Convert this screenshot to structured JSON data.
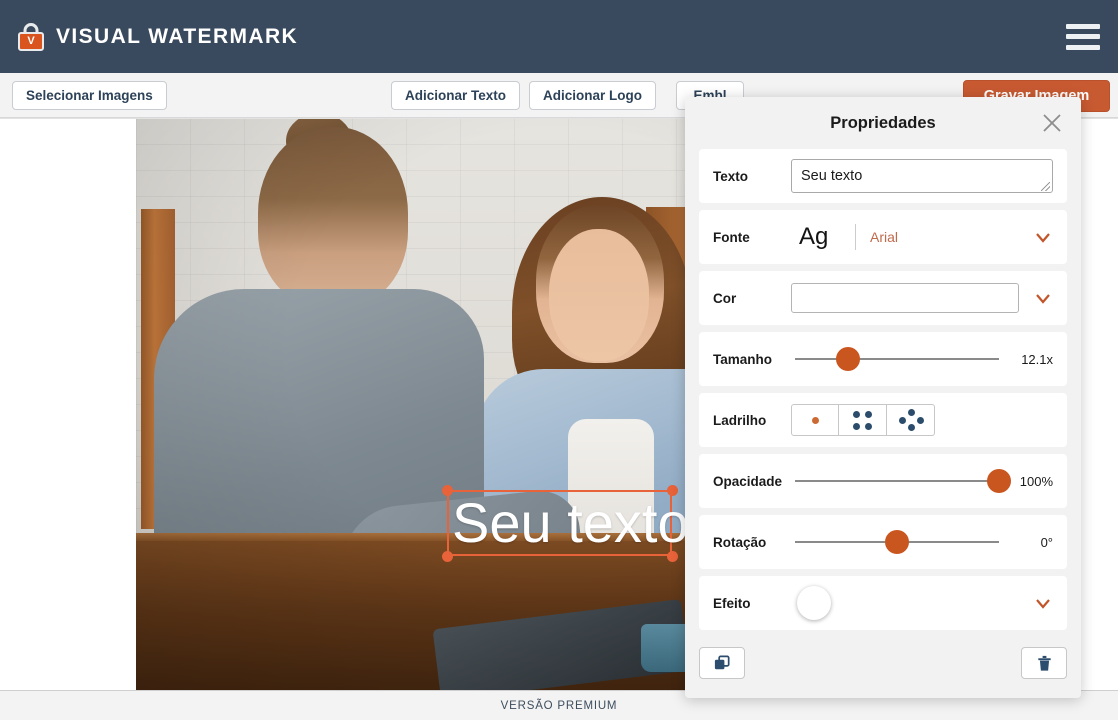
{
  "header": {
    "brand_name": "VISUAL WATERMARK",
    "logo_letter": "V",
    "logo_icon": "padlock-icon",
    "menu_icon": "hamburger-menu-icon",
    "bg_color": "#3a4a5e"
  },
  "toolbar": {
    "select_images_label": "Selecionar Imagens",
    "add_text_label": "Adicionar Texto",
    "add_logo_label": "Adicionar Logo",
    "third_label": "Embl",
    "primary_label": "Gravar Imagem",
    "primary_color": "#c85a32"
  },
  "canvas": {
    "watermark_text": "Seu texto",
    "watermark_color": "#ffffff",
    "selection_color": "#e8623a"
  },
  "panel": {
    "title": "Propriedades",
    "close_icon": "close-icon",
    "text": {
      "label": "Texto",
      "value": "Seu texto",
      "placeholder": "Seu texto"
    },
    "font": {
      "label": "Fonte",
      "preview": "Ag",
      "value": "Arial",
      "chevron_icon": "chevron-down-icon"
    },
    "color": {
      "label": "Cor",
      "value": "#ffffff",
      "chevron_icon": "chevron-down-icon"
    },
    "size": {
      "label": "Tamanho",
      "value": "12.1x",
      "percent": 26
    },
    "tile": {
      "label": "Ladrilho",
      "options": [
        "single-dot-icon",
        "grid-dots-icon",
        "diamond-dots-icon"
      ],
      "selected_index": 0
    },
    "opacity": {
      "label": "Opacidade",
      "value": "100%",
      "percent": 100
    },
    "rotation": {
      "label": "Rotação",
      "value": "0°",
      "percent": 50
    },
    "effect": {
      "label": "Efeito",
      "toggle_state": "off",
      "chevron_icon": "chevron-down-icon"
    },
    "footer_actions": {
      "duplicate_icon": "duplicate-icon",
      "delete_icon": "trash-icon"
    }
  },
  "footer": {
    "text": "VERSÃO PREMIUM"
  }
}
